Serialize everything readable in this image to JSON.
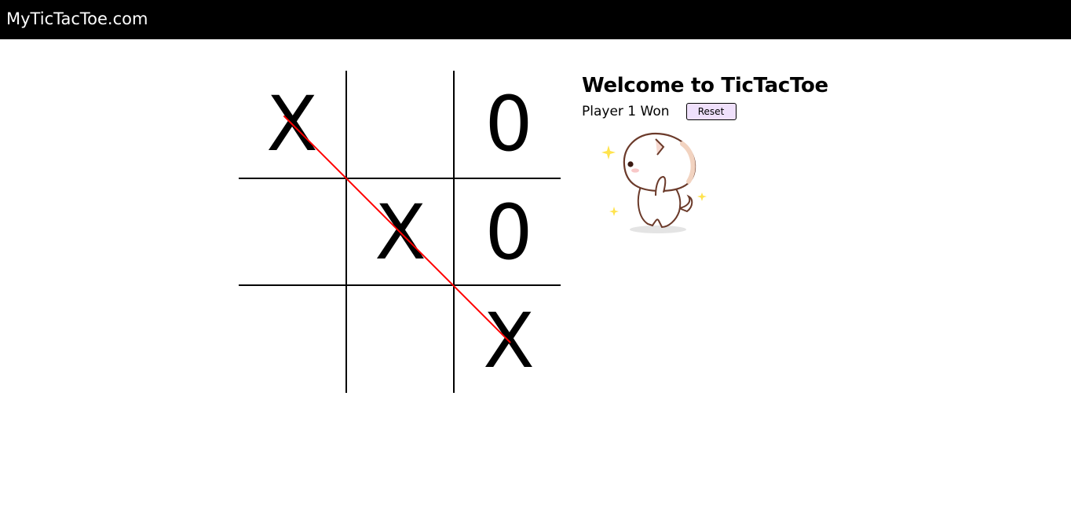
{
  "navbar": {
    "brand": "MyTicTacToe.com"
  },
  "game": {
    "board": [
      "X",
      "",
      "0",
      "",
      "X",
      "0",
      "",
      "",
      "X"
    ],
    "winning_line": [
      0,
      4,
      8
    ],
    "grid_color": "#000000",
    "win_line_color": "#ff0000"
  },
  "sidebar": {
    "title": "Welcome to TicTacToe",
    "status": "Player 1 Won",
    "reset_label": "Reset",
    "reset_color": "#efe0fb"
  },
  "celebration": {
    "icon": "dancing-cat-gif"
  }
}
